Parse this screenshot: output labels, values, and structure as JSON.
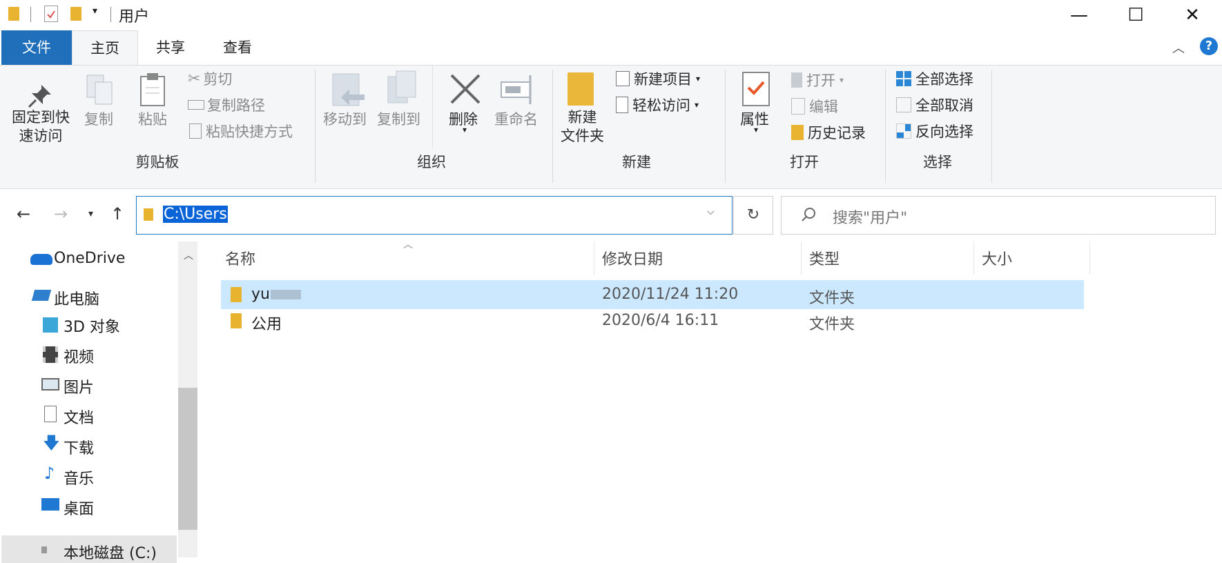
{
  "window": {
    "title": "用户",
    "minimize_glyph": "—",
    "maximize_glyph": "☐",
    "close_glyph": "✕"
  },
  "ribbon_tabs": [
    "文件",
    "主页",
    "共享",
    "查看"
  ],
  "help_glyph": "?",
  "ribbon": {
    "clipboard": {
      "pin_line1": "固定到快",
      "pin_line2": "速访问",
      "copy": "复制",
      "paste": "粘贴",
      "cut": "剪切",
      "copy_path": "复制路径",
      "paste_shortcut": "粘贴快捷方式",
      "label": "剪贴板"
    },
    "organize": {
      "move_to": "移动到",
      "copy_to": "复制到",
      "delete": "删除",
      "rename": "重命名",
      "label": "组织"
    },
    "new": {
      "new_folder_line1": "新建",
      "new_folder_line2": "文件夹",
      "new_item": "新建项目",
      "easy_access": "轻松访问",
      "label": "新建"
    },
    "open": {
      "properties": "属性",
      "open": "打开",
      "edit": "编辑",
      "history": "历史记录",
      "label": "打开"
    },
    "select": {
      "select_all": "全部选择",
      "select_none": "全部取消",
      "invert": "反向选择",
      "label": "选择"
    }
  },
  "address": {
    "path": "C:\\Users",
    "search_placeholder": "搜索\"用户\""
  },
  "sidebar": {
    "items": [
      {
        "label": "OneDrive",
        "icon": "cloud-icon"
      },
      {
        "label": "此电脑",
        "icon": "computer-icon"
      },
      {
        "label": "3D 对象",
        "icon": "3d-objects-icon"
      },
      {
        "label": "视频",
        "icon": "video-icon"
      },
      {
        "label": "图片",
        "icon": "pictures-icon"
      },
      {
        "label": "文档",
        "icon": "documents-icon"
      },
      {
        "label": "下载",
        "icon": "download-icon"
      },
      {
        "label": "音乐",
        "icon": "music-icon"
      },
      {
        "label": "桌面",
        "icon": "desktop-icon"
      },
      {
        "label": "本地磁盘 (C:)",
        "icon": "drive-icon"
      }
    ]
  },
  "file_list": {
    "columns": [
      "名称",
      "修改日期",
      "类型",
      "大小"
    ],
    "rows": [
      {
        "name": "yu",
        "modified": "2020/11/24 11:20",
        "type": "文件夹",
        "size": "",
        "selected": true
      },
      {
        "name": "公用",
        "modified": "2020/6/4 16:11",
        "type": "文件夹",
        "size": "",
        "selected": false
      }
    ]
  },
  "colors": {
    "accent": "#1f6fba",
    "selection": "#cce8ff",
    "folder": "#e8b32e"
  }
}
